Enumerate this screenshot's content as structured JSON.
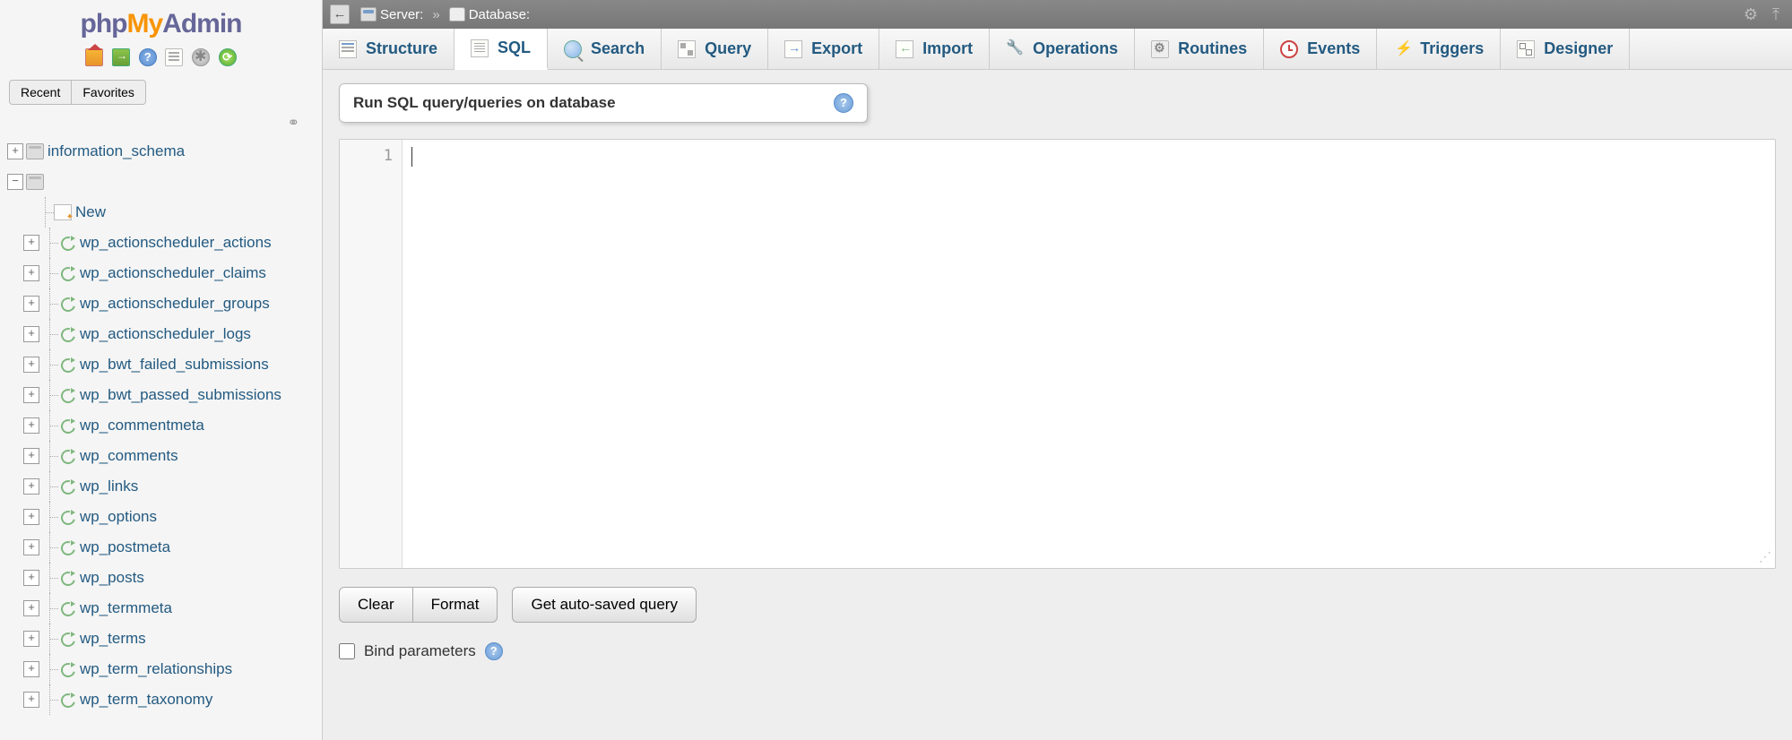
{
  "logo": {
    "p1": "php",
    "p2": "My",
    "p3": "Admin"
  },
  "sidebar": {
    "recent_label": "Recent",
    "favorites_label": "Favorites",
    "db_root": "information_schema",
    "new_label": "New",
    "tables": [
      "wp_actionscheduler_actions",
      "wp_actionscheduler_claims",
      "wp_actionscheduler_groups",
      "wp_actionscheduler_logs",
      "wp_bwt_failed_submissions",
      "wp_bwt_passed_submissions",
      "wp_commentmeta",
      "wp_comments",
      "wp_links",
      "wp_options",
      "wp_postmeta",
      "wp_posts",
      "wp_termmeta",
      "wp_terms",
      "wp_term_relationships",
      "wp_term_taxonomy"
    ]
  },
  "topbar": {
    "server_label": "Server:",
    "database_label": "Database:"
  },
  "tabs": {
    "structure": "Structure",
    "sql": "SQL",
    "search": "Search",
    "query": "Query",
    "export": "Export",
    "import": "Import",
    "operations": "Operations",
    "routines": "Routines",
    "events": "Events",
    "triggers": "Triggers",
    "designer": "Designer"
  },
  "panel": {
    "title": "Run SQL query/queries on database"
  },
  "editor": {
    "line1": "1"
  },
  "buttons": {
    "clear": "Clear",
    "format": "Format",
    "get_autosaved": "Get auto-saved query"
  },
  "bind": {
    "label": "Bind parameters"
  }
}
